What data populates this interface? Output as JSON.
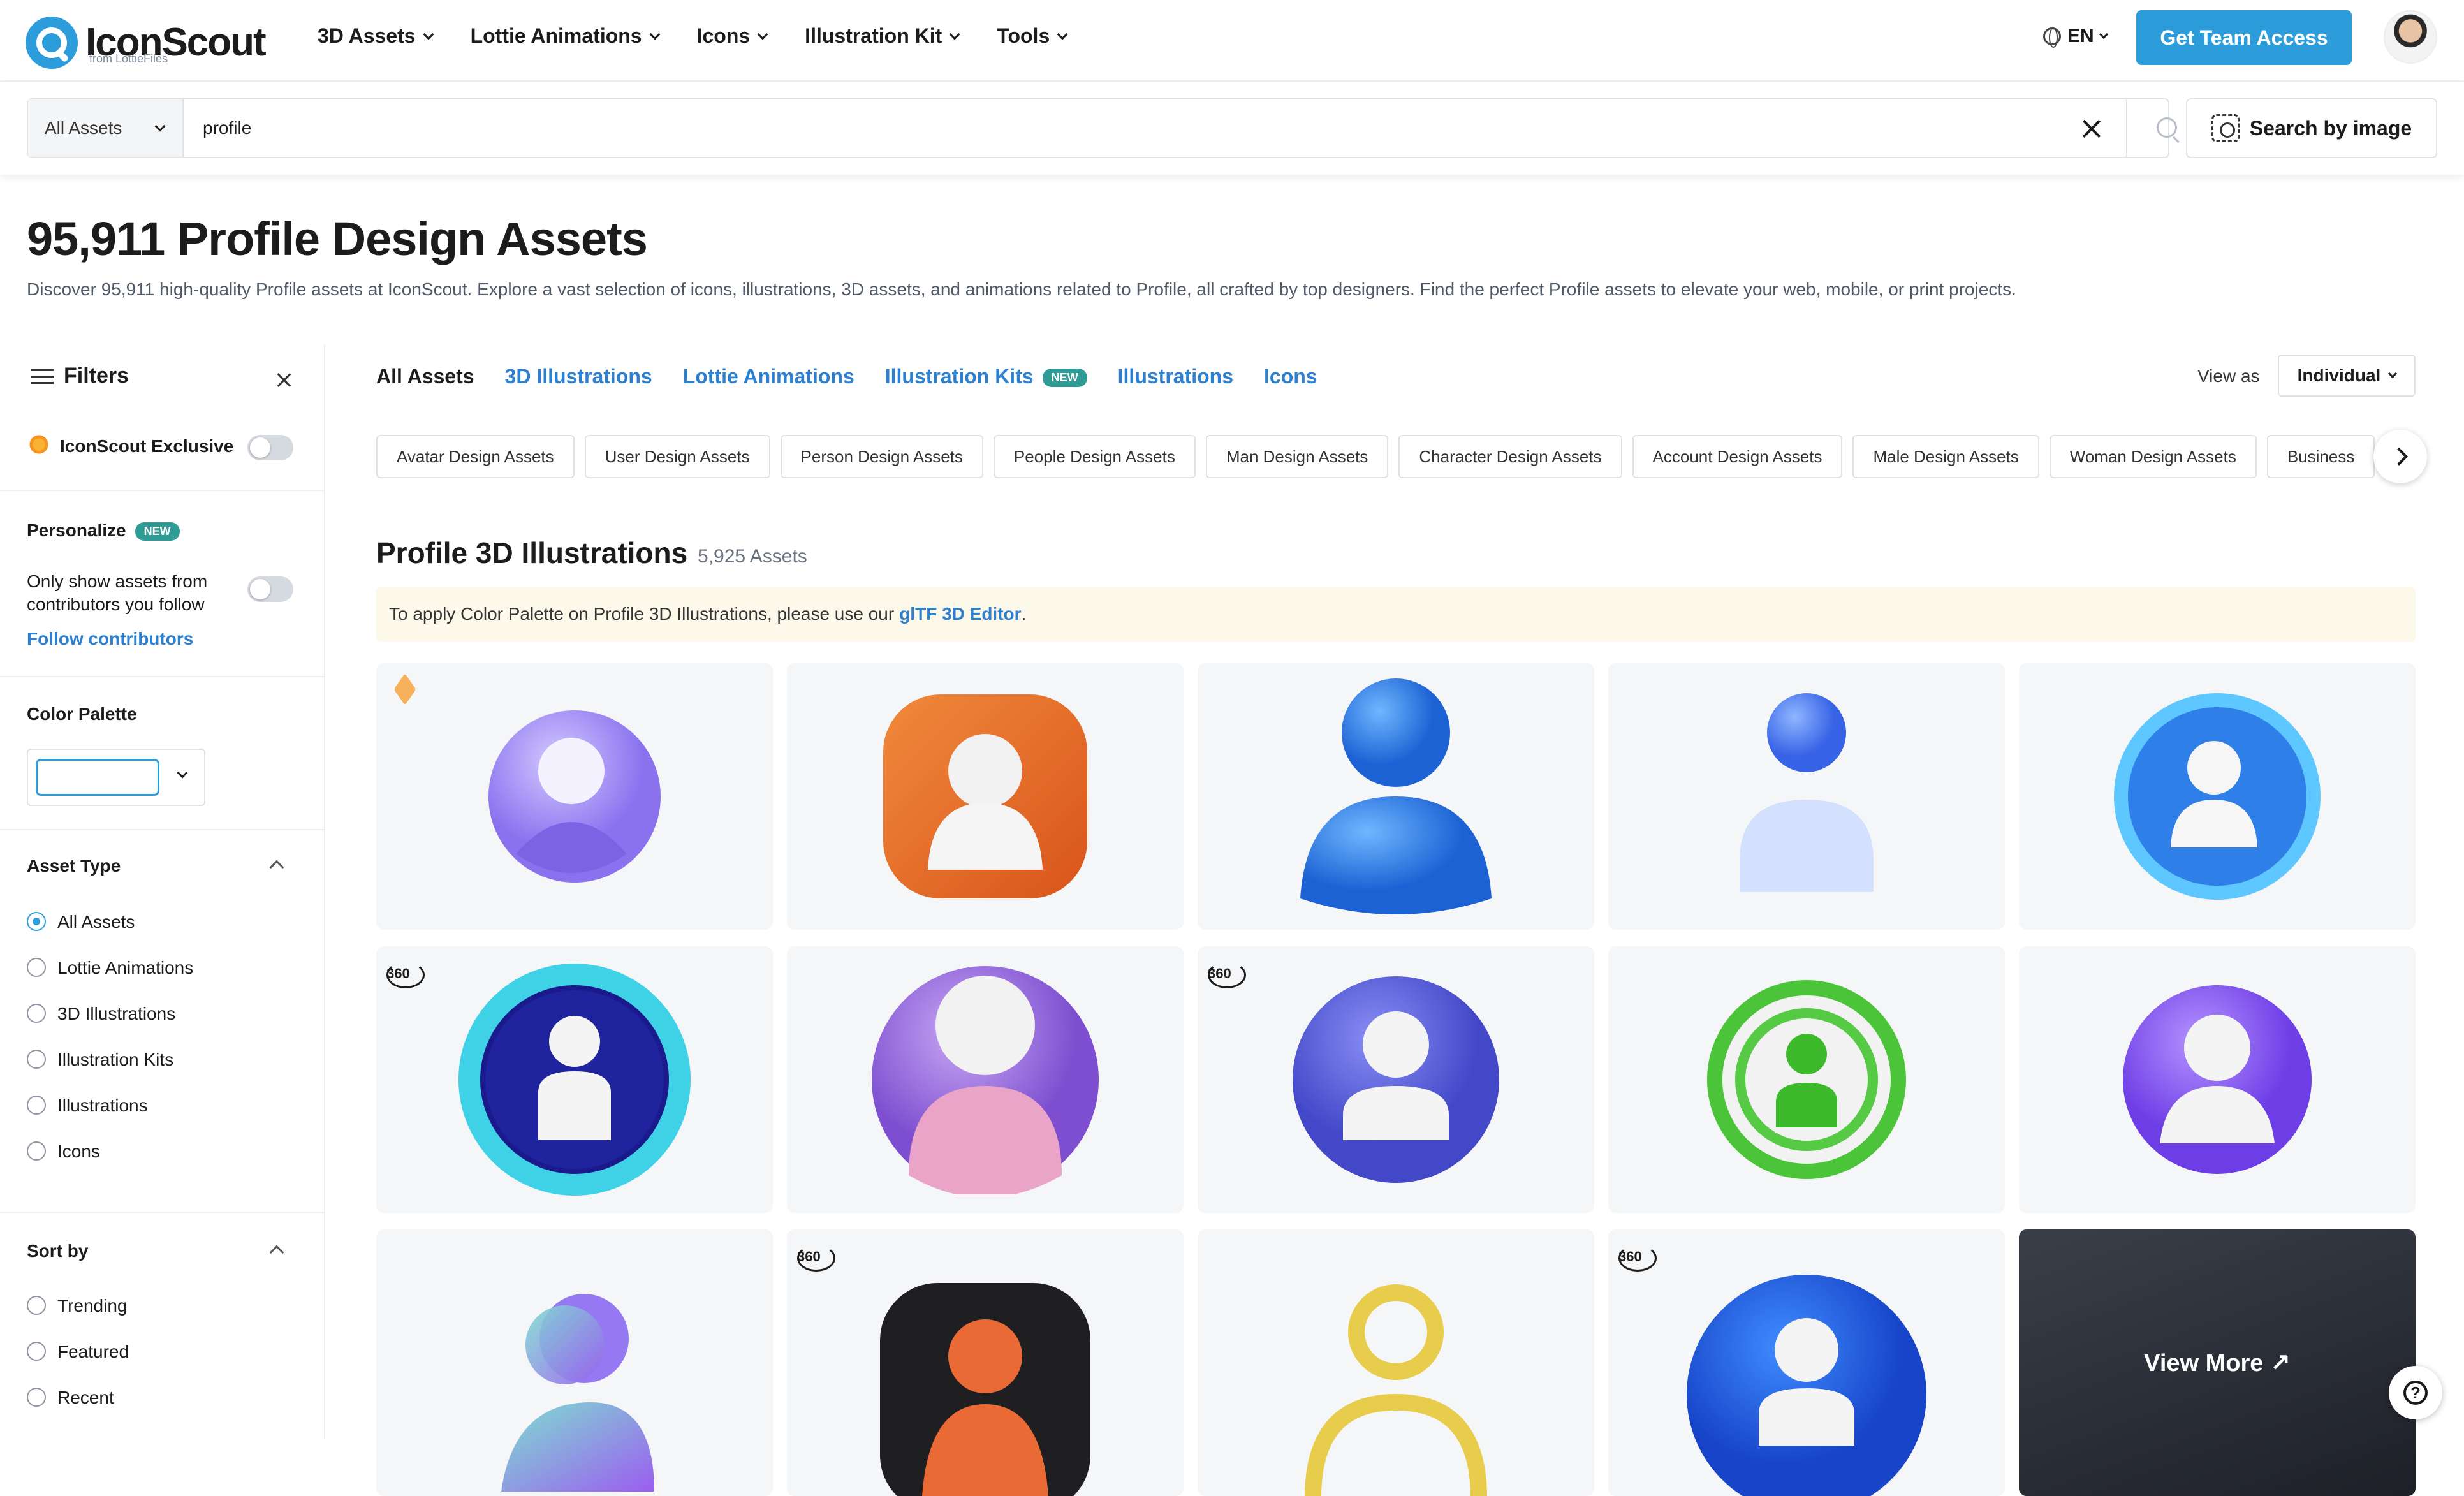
{
  "brand": {
    "name": "IconScout",
    "sub": "from LottieFiles"
  },
  "nav": [
    {
      "label": "3D Assets"
    },
    {
      "label": "Lottie Animations"
    },
    {
      "label": "Icons"
    },
    {
      "label": "Illustration Kit"
    },
    {
      "label": "Tools"
    }
  ],
  "header": {
    "lang": "EN",
    "cta": "Get Team Access"
  },
  "search": {
    "category": "All Assets",
    "query": "profile",
    "by_image": "Search by image"
  },
  "page": {
    "title": "95,911 Profile Design Assets",
    "description": "Discover 95,911 high-quality Profile assets at IconScout. Explore a vast selection of icons, illustrations, 3D assets, and animations related to Profile, all crafted by top designers. Find the perfect Profile assets to elevate your web, mobile, or print projects."
  },
  "sidebar": {
    "filters_title": "Filters",
    "exclusive": {
      "label": "IconScout Exclusive",
      "on": false
    },
    "personalize": {
      "title": "Personalize",
      "badge": "NEW",
      "follow_text_1": "Only show assets from",
      "follow_text_2": "contributors you follow",
      "link": "Follow contributors",
      "on": false
    },
    "color_palette": {
      "title": "Color Palette"
    },
    "asset_type": {
      "title": "Asset Type",
      "options": [
        "All Assets",
        "Lottie Animations",
        "3D Illustrations",
        "Illustration Kits",
        "Illustrations",
        "Icons"
      ],
      "selected": "All Assets"
    },
    "sort_by": {
      "title": "Sort by",
      "options": [
        "Trending",
        "Featured",
        "Recent"
      ]
    }
  },
  "tabs": [
    {
      "label": "All Assets",
      "active": true
    },
    {
      "label": "3D Illustrations"
    },
    {
      "label": "Lottie Animations"
    },
    {
      "label": "Illustration Kits",
      "badge": "NEW"
    },
    {
      "label": "Illustrations"
    },
    {
      "label": "Icons"
    }
  ],
  "view": {
    "label": "View as",
    "value": "Individual"
  },
  "chips": [
    "Avatar Design Assets",
    "User Design Assets",
    "Person Design Assets",
    "People Design Assets",
    "Man Design Assets",
    "Character Design Assets",
    "Account Design Assets",
    "Male Design Assets",
    "Woman Design Assets",
    "Business"
  ],
  "section": {
    "title": "Profile 3D Illustrations",
    "count": "5,925 Assets",
    "notice": "To apply Color Palette on Profile 3D Illustrations, please use our",
    "notice_link": "glTF 3D Editor",
    "notice_end": "."
  },
  "cards": [
    {
      "badge": "cube",
      "style": "lavender-circle"
    },
    {
      "badge": "",
      "style": "orange-squircle"
    },
    {
      "badge": "",
      "style": "blue-person"
    },
    {
      "badge": "",
      "style": "light-blue-person"
    },
    {
      "badge": "",
      "style": "blue-ring"
    },
    {
      "badge": "360",
      "style": "teal-ring"
    },
    {
      "badge": "",
      "style": "purple-pink"
    },
    {
      "badge": "360",
      "style": "indigo-circle"
    },
    {
      "badge": "",
      "style": "green-ring"
    },
    {
      "badge": "",
      "style": "violet-circle"
    },
    {
      "badge": "",
      "style": "glass-person"
    },
    {
      "badge": "360",
      "style": "black-squircle"
    },
    {
      "badge": "",
      "style": "yellow-outline"
    },
    {
      "badge": "360",
      "style": "blue-disc"
    },
    {
      "badge": "",
      "style": "view-more",
      "label": "View More ↗"
    }
  ],
  "colors": {
    "accent": "#2d9cdb",
    "link": "#2d7fcf",
    "badge": "#2e9c95"
  }
}
